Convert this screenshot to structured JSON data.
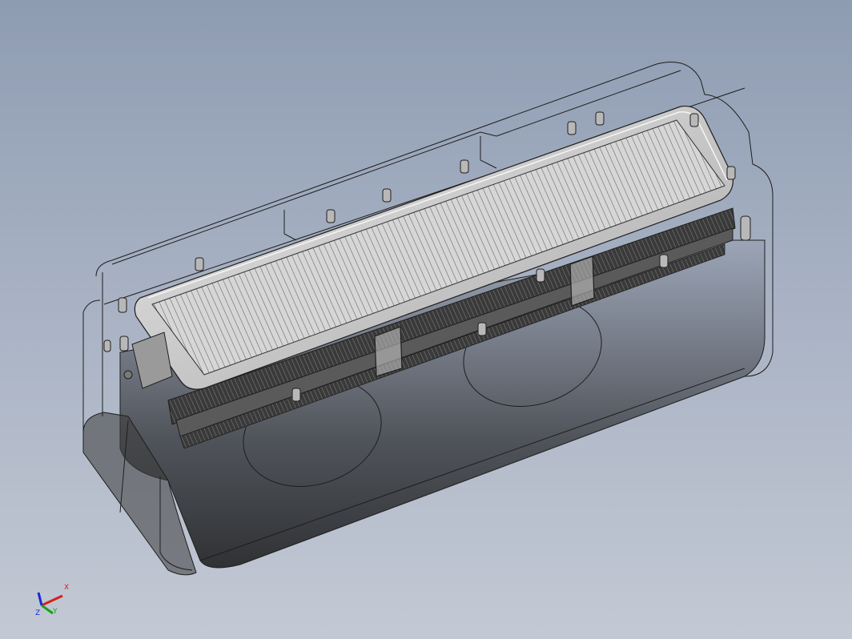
{
  "viewport": {
    "background_top": "#8e9cb2",
    "background_bottom": "#c3c9d4",
    "model_line_color": "#1e1e1e",
    "shadow_color": "#000000"
  },
  "triad": {
    "x_label": "X",
    "y_label": "Y",
    "z_label": "Z",
    "x_color": "#d42020",
    "y_color": "#1aa01a",
    "z_color": "#1a2ad4"
  }
}
